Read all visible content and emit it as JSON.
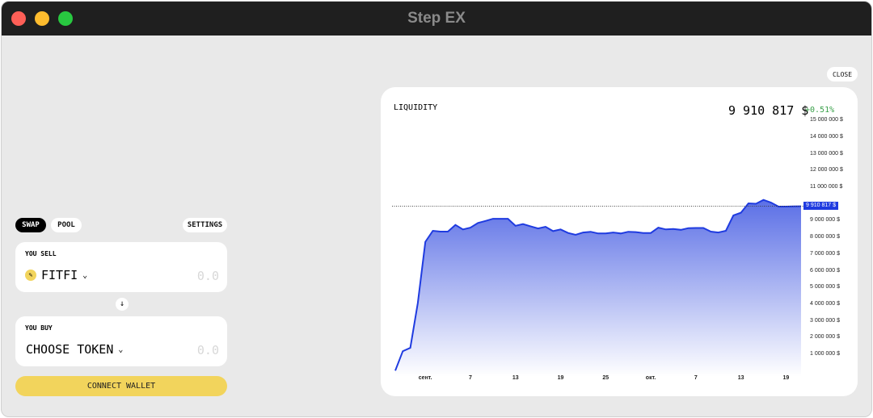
{
  "window": {
    "title": "Step EX"
  },
  "tabs": {
    "swap": "SWAP",
    "pool": "POOL",
    "settings": "SETTINGS"
  },
  "sell": {
    "label": "YOU SELL",
    "token": "FITFI",
    "amount_placeholder": "0.0"
  },
  "buy": {
    "label": "YOU BUY",
    "token": "CHOOSE TOKEN",
    "amount_placeholder": "0.0"
  },
  "connect_label": "CONNECT WALLET",
  "close_label": "CLOSE",
  "colors": {
    "accent": "#1f3be0",
    "yellow": "#f2d45c",
    "positive": "#3aa04a"
  },
  "liquidity": {
    "title": "LIQUIDITY",
    "value": "9 910 817 $",
    "change": "+0.51%",
    "current_tag": "9 910 817 $"
  },
  "chart_data": {
    "type": "area",
    "title": "LIQUIDITY",
    "ylabel": "USD",
    "ylim": [
      0,
      15000000
    ],
    "y_ticks": [
      "15 000 000 $",
      "14 000 000 $",
      "13 000 000 $",
      "12 000 000 $",
      "11 000 000 $",
      "9 000 000 $",
      "8 000 000 $",
      "7 000 000 $",
      "6 000 000 $",
      "5 000 000 $",
      "4 000 000 $",
      "3 000 000 $",
      "2 000 000 $",
      "1 000 000 $"
    ],
    "y_tick_values": [
      15,
      14,
      13,
      12,
      11,
      9,
      8,
      7,
      6,
      5,
      4,
      3,
      2,
      1
    ],
    "x_ticks": [
      {
        "label": "сент.",
        "i": 4
      },
      {
        "label": "7",
        "i": 10
      },
      {
        "label": "13",
        "i": 16
      },
      {
        "label": "19",
        "i": 22
      },
      {
        "label": "25",
        "i": 28
      },
      {
        "label": "окт.",
        "i": 34
      },
      {
        "label": "7",
        "i": 40
      },
      {
        "label": "13",
        "i": 46
      },
      {
        "label": "19",
        "i": 52
      }
    ],
    "values_millions": [
      0.07,
      1.23,
      1.43,
      4.12,
      7.78,
      8.44,
      8.39,
      8.39,
      8.79,
      8.52,
      8.63,
      8.91,
      9.03,
      9.16,
      9.16,
      9.16,
      8.74,
      8.84,
      8.71,
      8.58,
      8.68,
      8.42,
      8.52,
      8.31,
      8.2,
      8.34,
      8.38,
      8.28,
      8.28,
      8.34,
      8.28,
      8.38,
      8.36,
      8.31,
      8.31,
      8.63,
      8.52,
      8.55,
      8.5,
      8.6,
      8.61,
      8.61,
      8.39,
      8.34,
      8.44,
      9.36,
      9.52,
      10.08,
      10.06,
      10.29,
      10.13,
      9.89,
      9.89,
      9.9,
      9.91
    ],
    "current_value_millions": 9.910817
  }
}
